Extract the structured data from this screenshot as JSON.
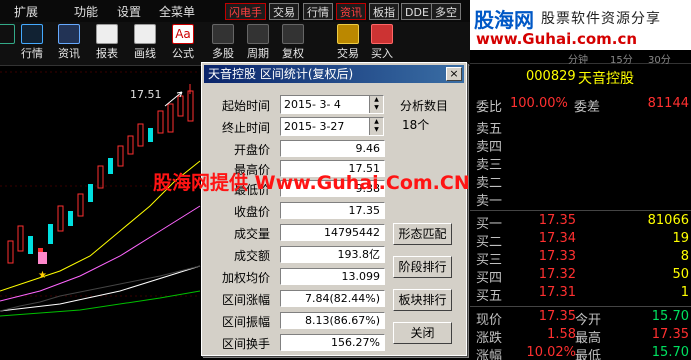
{
  "menu": {
    "items": [
      "扩展",
      "功能",
      "设置",
      "全菜单"
    ],
    "toggles": [
      "闪电手",
      "交易",
      "行情",
      "资讯",
      "板指",
      "DDE",
      "多空"
    ]
  },
  "logo": {
    "title": "股海网",
    "subtitle": "股票软件资源分享",
    "url": "www.Guhai.com.cn"
  },
  "toolbar": {
    "buttons": [
      "行情",
      "资讯",
      "报表",
      "画线",
      "公式",
      "多股",
      "周期",
      "复权",
      "交易",
      "买入"
    ]
  },
  "watermark": "股海网提供 Www.Guhai.Com.CN",
  "chart": {
    "price_label": "17.51"
  },
  "panel": {
    "tabs": [
      "",
      "",
      "",
      "分钟",
      "15分",
      "30分"
    ],
    "code": "000829",
    "name": "天音控股",
    "weibi_label": "委比",
    "weibi_value": "100.00%",
    "weicha_label": "委差",
    "weicha_value": "81144",
    "sell": [
      {
        "label": "卖五",
        "price": "",
        "vol": ""
      },
      {
        "label": "卖四",
        "price": "",
        "vol": ""
      },
      {
        "label": "卖三",
        "price": "",
        "vol": ""
      },
      {
        "label": "卖二",
        "price": "",
        "vol": ""
      },
      {
        "label": "卖一",
        "price": "",
        "vol": ""
      }
    ],
    "buy": [
      {
        "label": "买一",
        "price": "17.35",
        "vol": "81066"
      },
      {
        "label": "买二",
        "price": "17.34",
        "vol": "19"
      },
      {
        "label": "买三",
        "price": "17.33",
        "vol": "8"
      },
      {
        "label": "买四",
        "price": "17.32",
        "vol": "50"
      },
      {
        "label": "买五",
        "price": "17.31",
        "vol": "1"
      }
    ],
    "quote": [
      {
        "l1": "现价",
        "v1": "17.35",
        "l2": "今开",
        "v2": "15.70"
      },
      {
        "l1": "涨跌",
        "v1": "1.58",
        "l2": "最高",
        "v2": "17.35"
      },
      {
        "l1": "涨幅",
        "v1": "10.02%",
        "l2": "最低",
        "v2": "15.70"
      }
    ]
  },
  "dialog": {
    "title": "天音控股  区间统计(复权后)",
    "start_label": "起始时间",
    "start_value": "2015- 3- 4",
    "end_label": "终止时间",
    "end_value": "2015- 3-27",
    "count_label": "分析数目",
    "count_value": "18个",
    "fields": [
      {
        "label": "开盘价",
        "value": "9.46"
      },
      {
        "label": "最高价",
        "value": "17.51"
      },
      {
        "label": "最低价",
        "value": "9.38"
      },
      {
        "label": "收盘价",
        "value": "17.35"
      },
      {
        "label": "成交量",
        "value": "14795442"
      },
      {
        "label": "成交额",
        "value": "193.8亿"
      },
      {
        "label": "加权均价",
        "value": "13.099"
      },
      {
        "label": "区间涨幅",
        "value": "7.84(82.44%)"
      },
      {
        "label": "区间振幅",
        "value": "8.13(86.67%)"
      },
      {
        "label": "区间换手",
        "value": "156.27%"
      }
    ],
    "buttons": [
      "形态匹配",
      "阶段排行",
      "板块排行",
      "关闭"
    ],
    "close_x": "×"
  },
  "colors": {
    "up": "#ff3030",
    "down": "#00e0e0",
    "price": "#ffff00",
    "title_bar": "#0a246a"
  }
}
